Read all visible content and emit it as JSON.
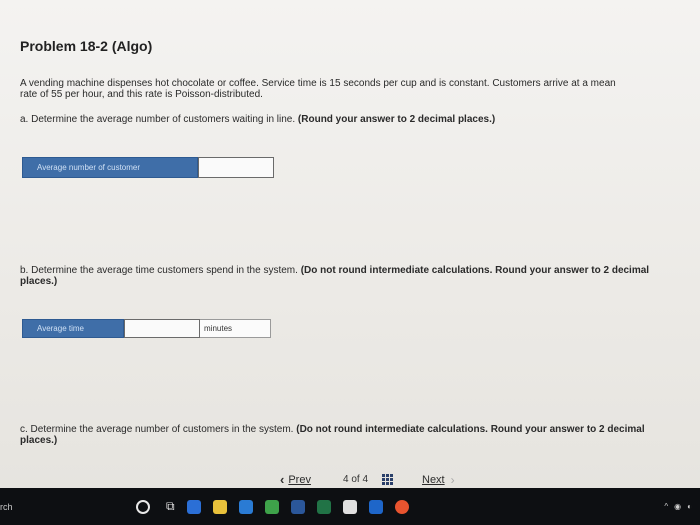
{
  "problem": {
    "title": "Problem 18-2 (Algo)",
    "intro_line1": "A vending machine dispenses hot chocolate or coffee. Service time is 15 seconds per cup and is constant. Customers arrive at a mean",
    "intro_line2": "rate of 55 per hour, and this rate is Poisson-distributed."
  },
  "part_a": {
    "question": "a. Determine the average number of customers waiting in line.",
    "instruction": "(Round your answer to 2 decimal places.)",
    "field_label": "Average number of customer",
    "field_value": ""
  },
  "part_b": {
    "question": "b. Determine the average time customers spend in the system.",
    "instruction": "(Do not round intermediate calculations. Round your answer to 2 decimal places.)",
    "field_label": "Average time",
    "field_value": "",
    "unit": "minutes"
  },
  "part_c": {
    "question": "c. Determine the average number of customers in the system.",
    "instruction": "(Do not round intermediate calculations. Round your answer to 2 decimal places.)"
  },
  "pager": {
    "prev_label": "Prev",
    "page_current": "4",
    "page_sep": "of",
    "page_total": "4",
    "next_label": "Next"
  },
  "taskbar": {
    "search_fragment": "rch"
  },
  "icons": {
    "prev": "chevron-left-icon",
    "next": "chevron-right-icon",
    "grid": "grid-icon"
  },
  "colors": {
    "field_label_bg": "#3f6ea8",
    "taskbar_bg": "#0d0f12"
  }
}
